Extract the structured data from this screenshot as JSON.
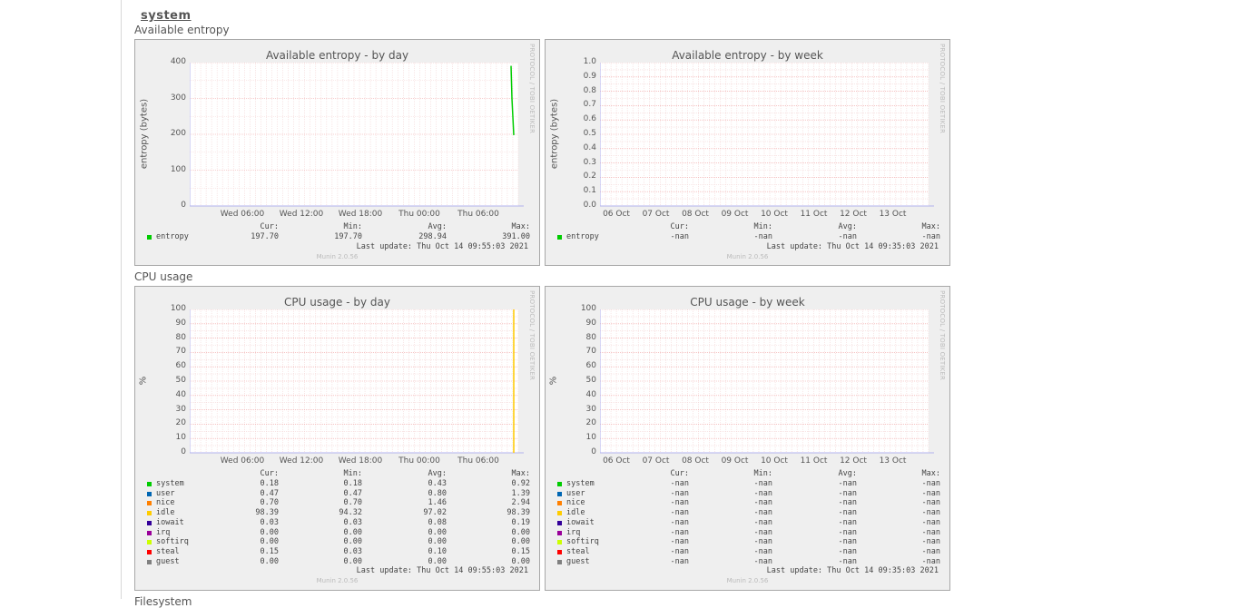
{
  "section": {
    "title": "system"
  },
  "graphs": [
    {
      "id": "entropy",
      "label": "Available entropy",
      "day": {
        "title": "Available entropy - by day",
        "ylabel": "entropy (bytes)",
        "yticks": [
          "400",
          "300",
          "200",
          "100",
          "0"
        ],
        "xticks": [
          "Wed 06:00",
          "Wed 12:00",
          "Wed 18:00",
          "Thu 00:00",
          "Thu 06:00"
        ],
        "headers": [
          "Cur:",
          "Min:",
          "Avg:",
          "Max:"
        ],
        "rows": [
          {
            "name": "entropy",
            "color": "#00cc00",
            "values": [
              "197.70",
              "197.70",
              "298.94",
              "391.00"
            ]
          }
        ],
        "last_update": "Last update: Thu Oct 14 09:55:03 2021",
        "footer": "Munin 2.0.56",
        "side": "PROTOCOL / TOBI OETIKER"
      },
      "week": {
        "title": "Available entropy - by week",
        "ylabel": "entropy (bytes)",
        "yticks": [
          "1.0",
          "0.9",
          "0.8",
          "0.7",
          "0.6",
          "0.5",
          "0.4",
          "0.3",
          "0.2",
          "0.1",
          "0.0"
        ],
        "xticks": [
          "06 Oct",
          "07 Oct",
          "08 Oct",
          "09 Oct",
          "10 Oct",
          "11 Oct",
          "12 Oct",
          "13 Oct"
        ],
        "headers": [
          "Cur:",
          "Min:",
          "Avg:",
          "Max:"
        ],
        "rows": [
          {
            "name": "entropy",
            "color": "#00cc00",
            "values": [
              "-nan",
              "-nan",
              "-nan",
              "-nan"
            ]
          }
        ],
        "last_update": "Last update: Thu Oct 14 09:35:03 2021",
        "footer": "Munin 2.0.56",
        "side": "PROTOCOL / TOBI OETIKER"
      }
    },
    {
      "id": "cpu",
      "label": "CPU usage",
      "day": {
        "title": "CPU usage - by day",
        "ylabel": "%",
        "yticks": [
          "100",
          "90",
          "80",
          "70",
          "60",
          "50",
          "40",
          "30",
          "20",
          "10",
          "0"
        ],
        "xticks": [
          "Wed 06:00",
          "Wed 12:00",
          "Wed 18:00",
          "Thu 00:00",
          "Thu 06:00"
        ],
        "headers": [
          "Cur:",
          "Min:",
          "Avg:",
          "Max:"
        ],
        "rows": [
          {
            "name": "system",
            "color": "#00cc00",
            "values": [
              "0.18",
              "0.18",
              "0.43",
              "0.92"
            ]
          },
          {
            "name": "user",
            "color": "#0066b3",
            "values": [
              "0.47",
              "0.47",
              "0.80",
              "1.39"
            ]
          },
          {
            "name": "nice",
            "color": "#ff8000",
            "values": [
              "0.70",
              "0.70",
              "1.46",
              "2.94"
            ]
          },
          {
            "name": "idle",
            "color": "#ffcc00",
            "values": [
              "98.39",
              "94.32",
              "97.02",
              "98.39"
            ]
          },
          {
            "name": "iowait",
            "color": "#330099",
            "values": [
              "0.03",
              "0.03",
              "0.08",
              "0.19"
            ]
          },
          {
            "name": "irq",
            "color": "#990099",
            "values": [
              "0.00",
              "0.00",
              "0.00",
              "0.00"
            ]
          },
          {
            "name": "softirq",
            "color": "#ccff00",
            "values": [
              "0.00",
              "0.00",
              "0.00",
              "0.00"
            ]
          },
          {
            "name": "steal",
            "color": "#ff0000",
            "values": [
              "0.15",
              "0.03",
              "0.10",
              "0.15"
            ]
          },
          {
            "name": "guest",
            "color": "#808080",
            "values": [
              "0.00",
              "0.00",
              "0.00",
              "0.00"
            ]
          }
        ],
        "last_update": "Last update: Thu Oct 14 09:55:03 2021",
        "footer": "Munin 2.0.56",
        "side": "PROTOCOL / TOBI OETIKER"
      },
      "week": {
        "title": "CPU usage - by week",
        "ylabel": "%",
        "yticks": [
          "100",
          "90",
          "80",
          "70",
          "60",
          "50",
          "40",
          "30",
          "20",
          "10",
          "0"
        ],
        "xticks": [
          "06 Oct",
          "07 Oct",
          "08 Oct",
          "09 Oct",
          "10 Oct",
          "11 Oct",
          "12 Oct",
          "13 Oct"
        ],
        "headers": [
          "Cur:",
          "Min:",
          "Avg:",
          "Max:"
        ],
        "rows": [
          {
            "name": "system",
            "color": "#00cc00",
            "values": [
              "-nan",
              "-nan",
              "-nan",
              "-nan"
            ]
          },
          {
            "name": "user",
            "color": "#0066b3",
            "values": [
              "-nan",
              "-nan",
              "-nan",
              "-nan"
            ]
          },
          {
            "name": "nice",
            "color": "#ff8000",
            "values": [
              "-nan",
              "-nan",
              "-nan",
              "-nan"
            ]
          },
          {
            "name": "idle",
            "color": "#ffcc00",
            "values": [
              "-nan",
              "-nan",
              "-nan",
              "-nan"
            ]
          },
          {
            "name": "iowait",
            "color": "#330099",
            "values": [
              "-nan",
              "-nan",
              "-nan",
              "-nan"
            ]
          },
          {
            "name": "irq",
            "color": "#990099",
            "values": [
              "-nan",
              "-nan",
              "-nan",
              "-nan"
            ]
          },
          {
            "name": "softirq",
            "color": "#ccff00",
            "values": [
              "-nan",
              "-nan",
              "-nan",
              "-nan"
            ]
          },
          {
            "name": "steal",
            "color": "#ff0000",
            "values": [
              "-nan",
              "-nan",
              "-nan",
              "-nan"
            ]
          },
          {
            "name": "guest",
            "color": "#808080",
            "values": [
              "-nan",
              "-nan",
              "-nan",
              "-nan"
            ]
          }
        ],
        "last_update": "Last update: Thu Oct 14 09:35:03 2021",
        "footer": "Munin 2.0.56",
        "side": "PROTOCOL / TOBI OETIKER"
      }
    }
  ],
  "next_label": "Filesystem"
}
